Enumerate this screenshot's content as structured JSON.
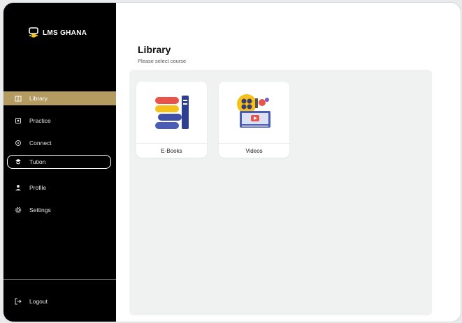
{
  "brand": {
    "name": "LMS GHANA"
  },
  "sidebar": {
    "items": [
      {
        "label": "Library",
        "icon": "book-icon"
      },
      {
        "label": "Practice",
        "icon": "practice-icon"
      },
      {
        "label": "Connect",
        "icon": "connect-icon"
      },
      {
        "label": "Tution",
        "icon": "graduation-icon"
      },
      {
        "label": "Profile",
        "icon": "user-icon"
      },
      {
        "label": "Settings",
        "icon": "gear-icon"
      }
    ],
    "logout_label": "Logout",
    "active_item": "Library"
  },
  "main": {
    "title": "Library",
    "subtitle": "Please select course",
    "cards": [
      {
        "label": "E-Books",
        "icon": "books-icon"
      },
      {
        "label": "Videos",
        "icon": "video-icon"
      }
    ]
  },
  "colors": {
    "sidebar_bg": "#000000",
    "active_bg": "#b39b62",
    "panel_bg": "#f0f1f1"
  }
}
